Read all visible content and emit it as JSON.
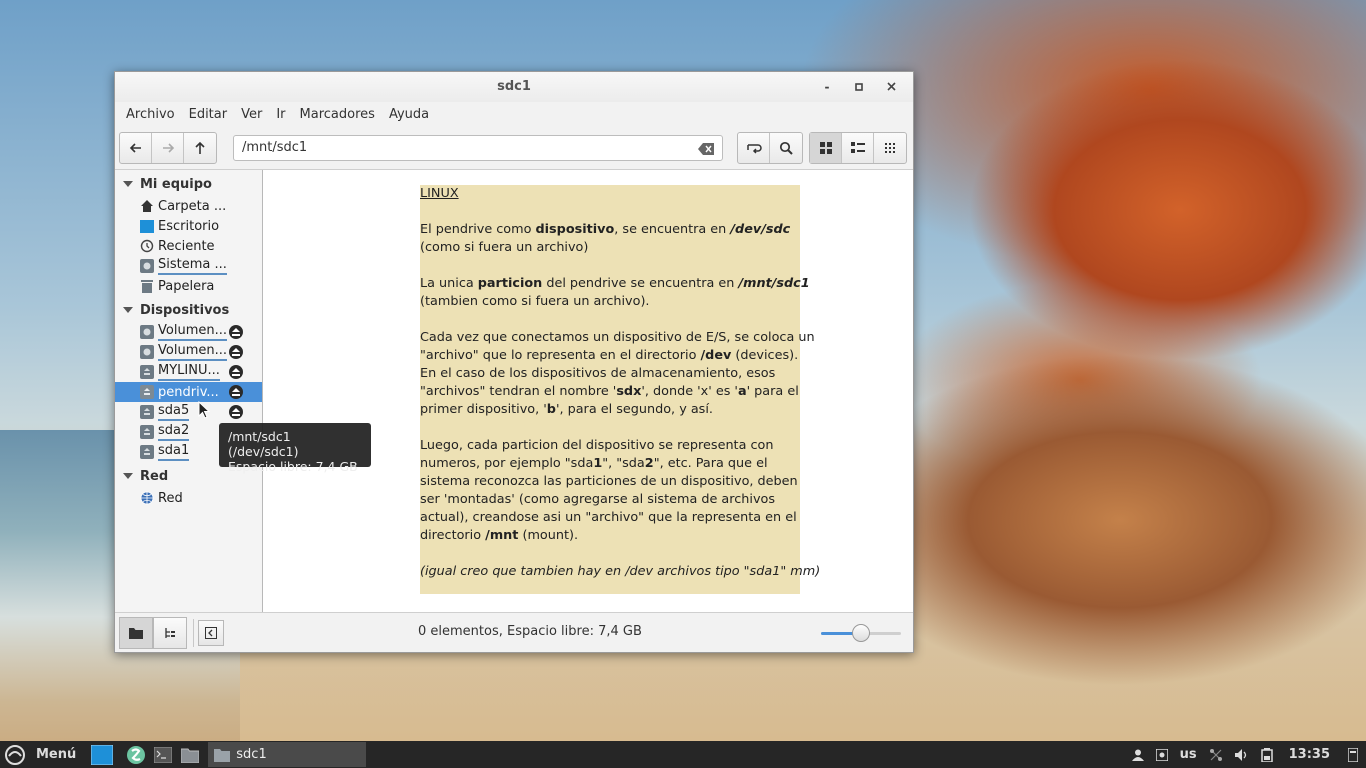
{
  "window": {
    "title": "sdc1",
    "minimize": "-",
    "maximize": "▫",
    "close": "✕"
  },
  "menu": [
    "Archivo",
    "Editar",
    "Ver",
    "Ir",
    "Marcadores",
    "Ayuda"
  ],
  "toolbar": {
    "location": "/mnt/sdc1"
  },
  "sidebar": {
    "sections": [
      {
        "title": "Mi equipo"
      },
      {
        "title": "Dispositivos"
      },
      {
        "title": "Red"
      }
    ],
    "my_computer": [
      {
        "label": "Carpeta ...",
        "icon": "home-icon"
      },
      {
        "label": "Escritorio",
        "icon": "desktop-icon"
      },
      {
        "label": "Reciente",
        "icon": "clock-icon"
      },
      {
        "label": "Sistema ...",
        "icon": "drive-icon"
      },
      {
        "label": "Papelera",
        "icon": "trash-icon"
      }
    ],
    "devices": [
      {
        "label": "Volumen...",
        "icon": "drive-icon"
      },
      {
        "label": "Volumen...",
        "icon": "drive-icon"
      },
      {
        "label": "MYLINU...",
        "icon": "usb-drive-icon"
      },
      {
        "label": "pendriv...",
        "icon": "usb-drive-icon",
        "selected": true
      },
      {
        "label": "sda5",
        "icon": "usb-drive-icon"
      },
      {
        "label": "sda2",
        "icon": "usb-drive-icon"
      },
      {
        "label": "sda1",
        "icon": "usb-drive-icon"
      }
    ],
    "network": [
      {
        "label": "Red",
        "icon": "network-icon"
      }
    ]
  },
  "tooltip": {
    "line1": "/mnt/sdc1 (/dev/sdc1)",
    "line2": "Espacio libre: 7,4 GB"
  },
  "note": {
    "heading": "LINUX",
    "p1_a": "El pendrive como ",
    "p1_b": "dispositivo",
    "p1_c": ", se encuentra en ",
    "p1_d": "/dev/sdc",
    "p1_e": "(como si fuera un archivo)",
    "p2_a": "La unica ",
    "p2_b": "particion",
    "p2_c": " del pendrive se encuentra en ",
    "p2_d": "/mnt/sdc1",
    "p2_e": "(tambien como si fuera un archivo).",
    "p3_l1": "Cada vez que conectamos un dispositivo de E/S, se coloca un",
    "p3_l2a": "\"archivo\" que lo representa en el directorio ",
    "p3_l2b": "/dev",
    "p3_l2c": " (devices).",
    "p3_l3": "En el caso de los dispositivos de almacenamiento, esos",
    "p3_l4a": "\"archivos\" tendran el nombre '",
    "p3_l4b": "sdx",
    "p3_l4c": "', donde 'x' es '",
    "p3_l4d": "a",
    "p3_l4e": "' para el",
    "p3_l5a": "primer dispositivo, '",
    "p3_l5b": "b",
    "p3_l5c": "', para el segundo, y así.",
    "p4_l1": "Luego, cada particion del dispositivo se representa con",
    "p4_l2a": "numeros, por ejemplo \"sda",
    "p4_l2b": "1",
    "p4_l2c": "\", \"sda",
    "p4_l2d": "2",
    "p4_l2e": "\", etc. Para que el",
    "p4_l3": "sistema reconozca las particiones de un dispositivo, deben",
    "p4_l4": "ser 'montadas' (como agregarse al sistema de archivos",
    "p4_l5": "actual), creandose asi un \"archivo\" que la representa en el",
    "p4_l6a": "directorio ",
    "p4_l6b": "/mnt",
    "p4_l6c": " (mount).",
    "p5": "(igual creo que tambien hay en /dev archivos tipo \"sda1\" mm)"
  },
  "status": {
    "text": "0 elementos, Espacio libre: 7,4 GB",
    "zoom_level": 0.5
  },
  "taskbar": {
    "menu_label": "Menú",
    "window_label": "sdc1",
    "keyboard": "us",
    "clock": "13:35"
  },
  "colors": {
    "accent": "#4a90d9",
    "note_bg": "#ede1b5",
    "taskbar": "#262626"
  }
}
